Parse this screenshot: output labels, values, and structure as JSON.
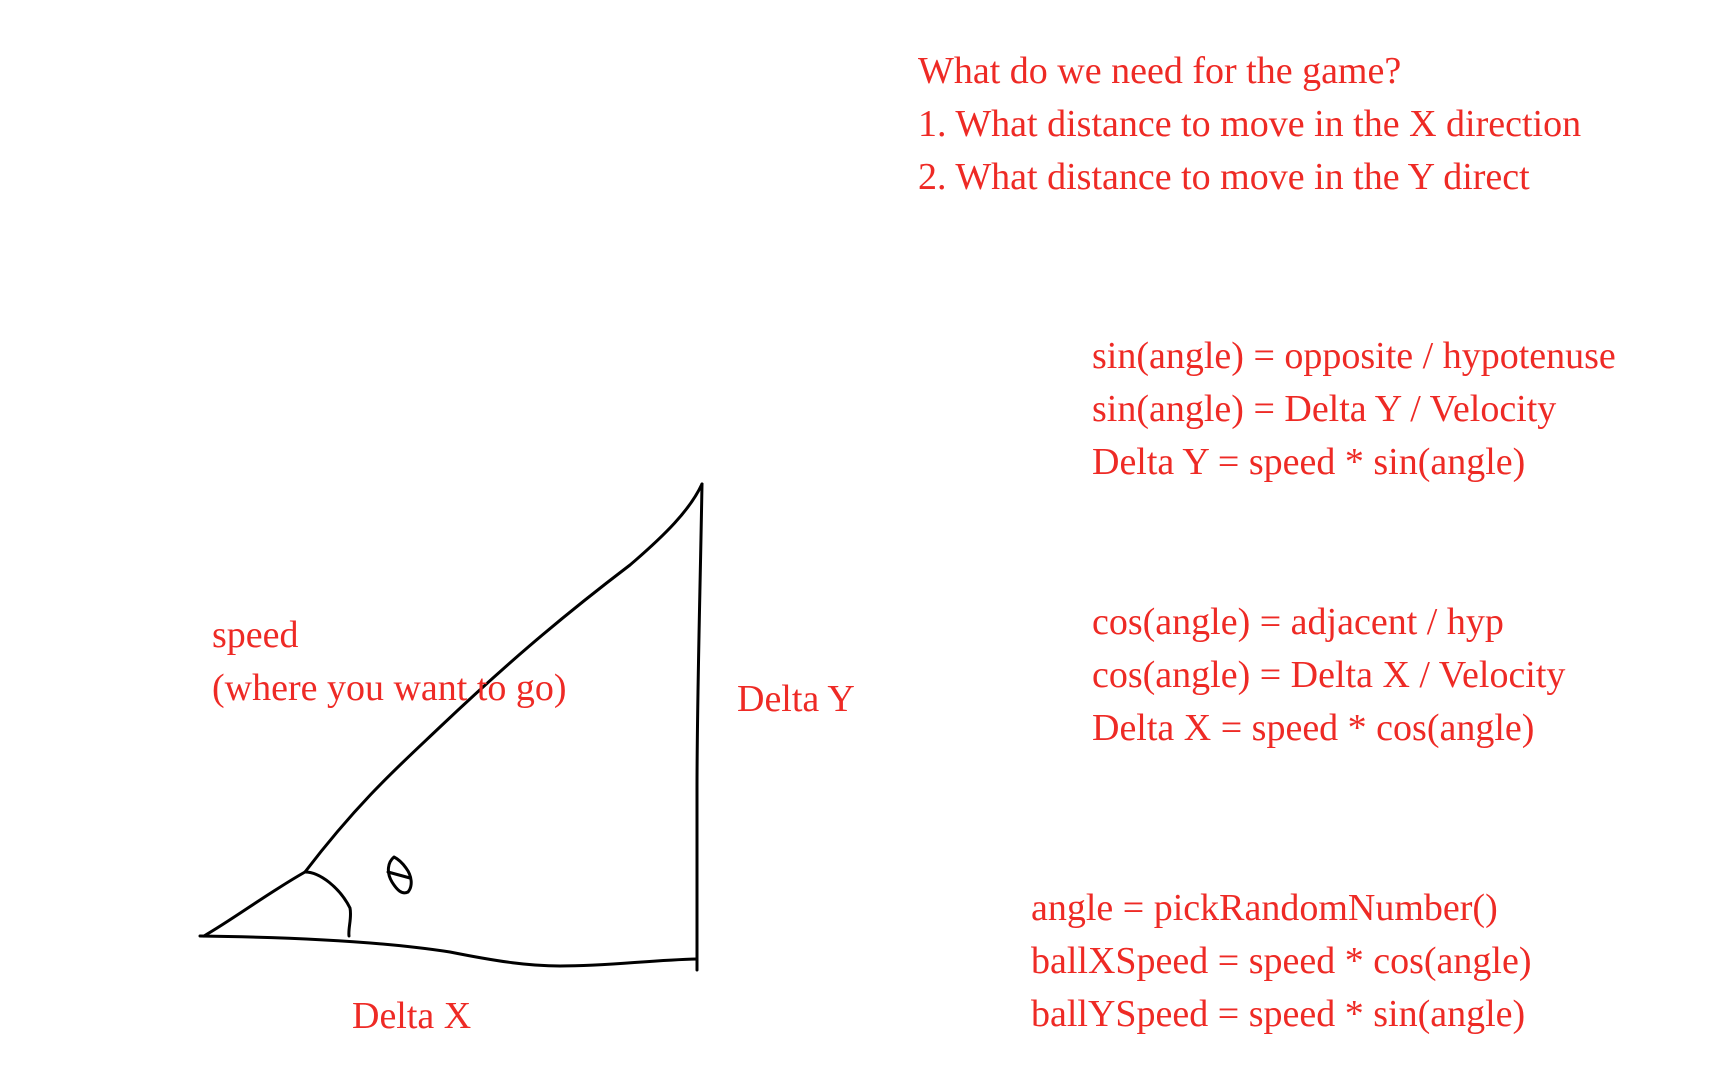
{
  "questions": {
    "heading": "What do we need for the game?",
    "items": [
      "1. What distance to move in the X direction",
      "2. What distance to move in the Y direct"
    ]
  },
  "sin_block": [
    "sin(angle) = opposite / hypotenuse",
    "sin(angle) = Delta Y / Velocity",
    "Delta Y = speed * sin(angle)"
  ],
  "cos_block": [
    "cos(angle) = adjacent / hyp",
    "cos(angle) = Delta X / Velocity",
    "Delta X = speed * cos(angle)"
  ],
  "code_block": [
    "angle = pickRandomNumber()",
    "ballXSpeed = speed * cos(angle)",
    "ballYSpeed = speed * sin(angle)"
  ],
  "diagram": {
    "hypotenuse_label": "speed",
    "hypotenuse_sublabel": "(where you want to go)",
    "vertical_label": "Delta Y",
    "horizontal_label": "Delta X"
  },
  "colors": {
    "text": "#ee2a25",
    "ink": "#000000",
    "background": "#ffffff"
  }
}
